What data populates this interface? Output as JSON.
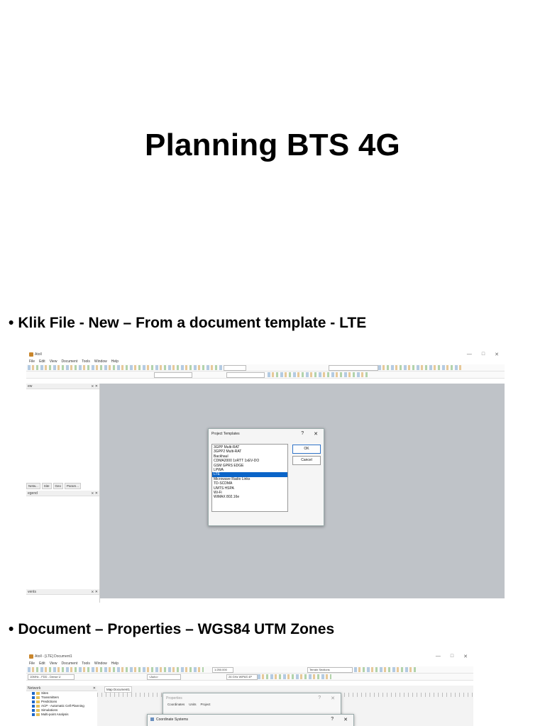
{
  "slide": {
    "title": "Planning BTS 4G",
    "bullet1": "Klik File - New – From a document template - LTE",
    "bullet2": "Document – Properties – WGS84 UTM Zones",
    "bullet_symbol": "•"
  },
  "shot1": {
    "app_title": "Atoll",
    "window_controls": [
      "—",
      "□",
      "✕"
    ],
    "menu": [
      "File",
      "Edit",
      "View",
      "Document",
      "Tools",
      "Window",
      "Help"
    ],
    "pane_top_label": "ew",
    "pane_tabs": [
      "Netw...",
      "Site",
      "Geo",
      "Param..."
    ],
    "pane_mid_label": "egend",
    "pane_bottom_label": "vents",
    "pane_close": "⨯ ✕",
    "dialog": {
      "title": "Project Templates",
      "help": "?",
      "close": "✕",
      "templates": [
        "3GPP Multi-RAT",
        "3GPP2 Multi-RAT",
        "Backhaul",
        "CDMA2000 1xRTT 1xEV-DO",
        "GSM GPRS EDGE",
        "LPWA",
        "LTE",
        "Microwave Radio Links",
        "TD-SCDMA",
        "UMTS HSPA",
        "Wi-Fi",
        "WiMAX 802.16e"
      ],
      "selected": "LTE",
      "ok_label": "OK",
      "cancel_label": "Cancel"
    }
  },
  "shot2": {
    "app_title": "Atoll - [LTE] Document1",
    "window_controls": [
      "—",
      "□",
      "✕"
    ],
    "menu": [
      "File",
      "Edit",
      "View",
      "Document",
      "Tools",
      "Window",
      "Help"
    ],
    "combo_band": "10MHz - FDD - Dense U",
    "combo_auto": "<Auto>",
    "combo_scale": "1:250.000",
    "combo_freq": "26 GHz WiPAS 4P",
    "combo_terrain": "Terrain Sections",
    "pane_label": "Network",
    "tree": [
      "Sites",
      "Transmitters",
      "Predictions",
      "ACP - Automatic Cell Planning",
      "Simulations",
      "Multi-point Analysis"
    ],
    "map_tab": "Map Document1",
    "properties_title": "Properties",
    "properties_tabs": [
      "Coordinates",
      "Units",
      "Project"
    ],
    "coord_title": "Coordinate Systems",
    "help": "?",
    "close": "✕"
  }
}
